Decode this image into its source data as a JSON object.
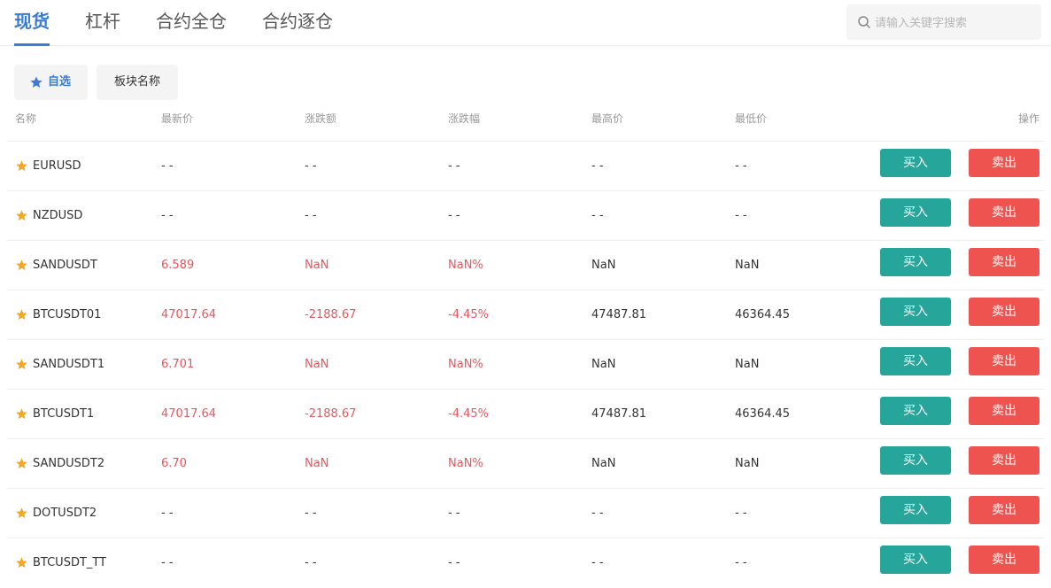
{
  "tabs": [
    {
      "label": "现货"
    },
    {
      "label": "杠杆"
    },
    {
      "label": "合约全仓"
    },
    {
      "label": "合约逐仓"
    }
  ],
  "search": {
    "placeholder": "请输入关键字搜索"
  },
  "filters": {
    "favorites_label": "自选",
    "sector_label": "板块名称"
  },
  "table": {
    "headers": {
      "name": "名称",
      "price": "最新价",
      "change": "涨跌额",
      "change_pct": "涨跌幅",
      "high": "最高价",
      "low": "最低价",
      "action": "操作"
    },
    "buy_label": "买入",
    "sell_label": "卖出",
    "rows": [
      {
        "symbol": "EURUSD",
        "price": "- -",
        "change": "- -",
        "change_pct": "- -",
        "high": "- -",
        "low": "- -"
      },
      {
        "symbol": "NZDUSD",
        "price": "- -",
        "change": "- -",
        "change_pct": "- -",
        "high": "- -",
        "low": "- -"
      },
      {
        "symbol": "SANDUSDT",
        "price": "6.589",
        "change": "NaN",
        "change_pct": "NaN%",
        "high": "NaN",
        "low": "NaN"
      },
      {
        "symbol": "BTCUSDT01",
        "price": "47017.64",
        "change": "-2188.67",
        "change_pct": "-4.45%",
        "high": "47487.81",
        "low": "46364.45"
      },
      {
        "symbol": "SANDUSDT1",
        "price": "6.701",
        "change": "NaN",
        "change_pct": "NaN%",
        "high": "NaN",
        "low": "NaN"
      },
      {
        "symbol": "BTCUSDT1",
        "price": "47017.64",
        "change": "-2188.67",
        "change_pct": "-4.45%",
        "high": "47487.81",
        "low": "46364.45"
      },
      {
        "symbol": "SANDUSDT2",
        "price": "6.70",
        "change": "NaN",
        "change_pct": "NaN%",
        "high": "NaN",
        "low": "NaN"
      },
      {
        "symbol": "DOTUSDT2",
        "price": "- -",
        "change": "- -",
        "change_pct": "- -",
        "high": "- -",
        "low": "- -"
      },
      {
        "symbol": "BTCUSDT_TT",
        "price": "- -",
        "change": "- -",
        "change_pct": "- -",
        "high": "- -",
        "low": "- -"
      }
    ]
  },
  "colors": {
    "accent": "#3a7bd5",
    "star": "#f5a623",
    "down": "#e8555c",
    "buy": "#26a69a",
    "sell": "#ef5350"
  },
  "icons": {
    "search": "search-icon",
    "favorite": "star-icon"
  }
}
